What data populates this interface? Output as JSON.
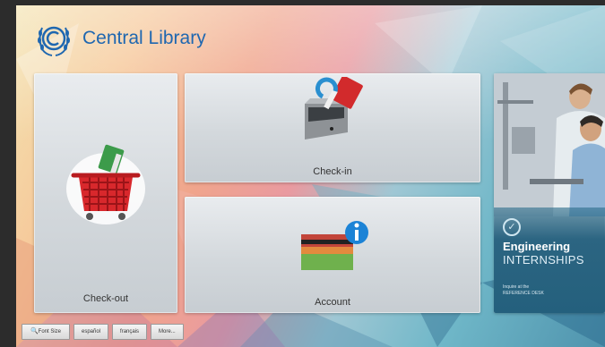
{
  "header": {
    "brand_name": "Central Library"
  },
  "tiles": {
    "checkout": {
      "label": "Check-out"
    },
    "checkin": {
      "label": "Check-in"
    },
    "account": {
      "label": "Account"
    }
  },
  "promo": {
    "title": "Engineering",
    "subtitle": "INTERNSHIPS",
    "line1": "Inquire at the",
    "line2": "REFERENCE DESK"
  },
  "bottom_bar": {
    "font_size_label": "Font Size",
    "languages": [
      "español",
      "français"
    ],
    "more_label": "More..."
  },
  "colors": {
    "brand": "#1f67b0",
    "promo_bg": "#24607d"
  },
  "icons": {
    "logo": "copyright-laurel-logo",
    "checkout": "shopping-basket-icon",
    "checkin": "book-return-slot-icon",
    "account": "library-card-info-icon",
    "font_size": "magnifier-icon"
  }
}
